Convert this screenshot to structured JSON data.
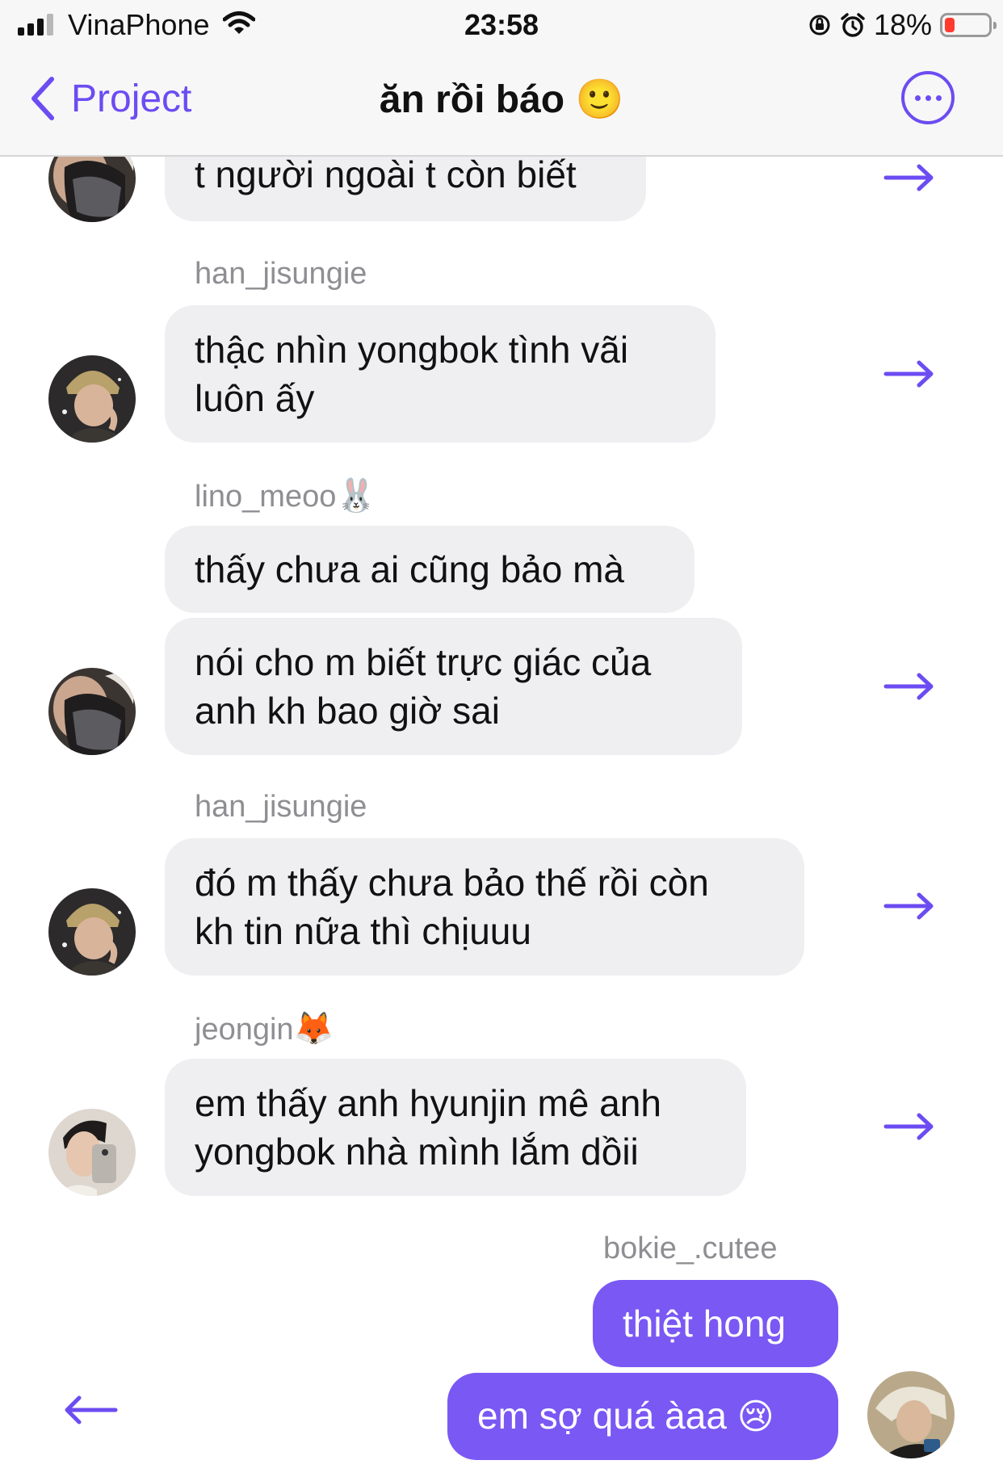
{
  "status_bar": {
    "carrier": "VinaPhone",
    "time": "23:58",
    "battery_percent": "18%",
    "battery_level": 0.18
  },
  "nav": {
    "back_label": "Project",
    "title": "ăn rồi báo",
    "title_emoji": "🙂"
  },
  "messages": [
    {
      "sender": "",
      "lines": [
        "t người ngoài t còn biết"
      ],
      "avatar": "masked-person"
    },
    {
      "sender": "han_jisungie",
      "lines": [
        "thậc nhìn yongbok tình vãi",
        "luôn ấy"
      ],
      "avatar": "beanie-person"
    },
    {
      "sender": "lino_meoo",
      "sender_emoji": "🐰",
      "lines": [
        "thấy chưa ai cũng bảo mà"
      ]
    },
    {
      "sender": "",
      "lines": [
        "nói cho m biết trực giác của",
        "anh kh bao giờ sai"
      ],
      "avatar": "masked-person"
    },
    {
      "sender": "han_jisungie",
      "lines": [
        "đó m thấy chưa bảo thế rồi còn",
        "kh tin nữa thì chịuuu"
      ],
      "avatar": "beanie-person"
    },
    {
      "sender": "jeongin",
      "sender_emoji": "🦊",
      "lines": [
        "em thấy anh hyunjin mê anh",
        "yongbok nhà mình lắm dồii"
      ],
      "avatar": "selfie-person"
    }
  ],
  "my_messages": {
    "sender": "bokie_.cutee",
    "bubbles": [
      {
        "text": "thiệt hong"
      },
      {
        "text": "em sợ quá àaa",
        "emoji": "😢"
      }
    ],
    "avatar": "blond-person"
  },
  "colors": {
    "accent": "#6c4cf2",
    "my_bubble": "#7a58f4",
    "their_bubble": "#efeff2",
    "sender_gray": "#8e8e93"
  }
}
